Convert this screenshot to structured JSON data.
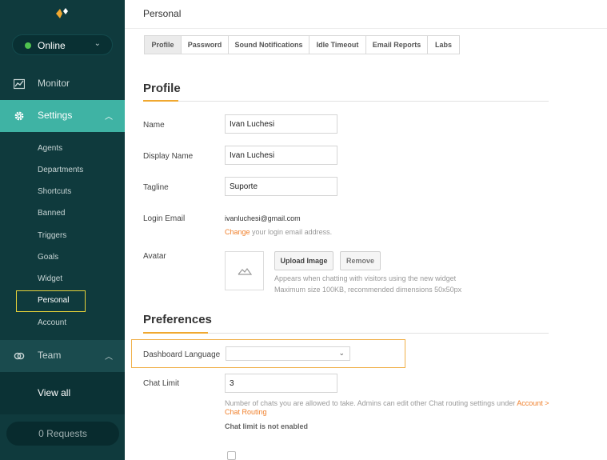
{
  "sidebar": {
    "status": {
      "label": "Online",
      "dot_color": "#4fc24f"
    },
    "nav": {
      "monitor": "Monitor",
      "settings": "Settings",
      "team": "Team"
    },
    "settings_items": [
      "Agents",
      "Departments",
      "Shortcuts",
      "Banned",
      "Triggers",
      "Goals",
      "Widget",
      "Personal",
      "Account"
    ],
    "active_item": "Personal",
    "view_all": "View all",
    "requests": "0 Requests",
    "colors": {
      "bg": "#0f3a3d",
      "active": "#3fb3a4",
      "highlight_box": "#e6d23a"
    }
  },
  "main": {
    "title": "Personal",
    "tabs": [
      "Profile",
      "Password",
      "Sound Notifications",
      "Idle Timeout",
      "Email Reports",
      "Labs"
    ],
    "active_tab": "Profile",
    "profile": {
      "heading": "Profile",
      "name_label": "Name",
      "name_value": "Ivan Luchesi",
      "display_name_label": "Display Name",
      "display_name_value": "Ivan Luchesi",
      "tagline_label": "Tagline",
      "tagline_value": "Suporte",
      "login_email_label": "Login Email",
      "login_email_value": "ivanluchesi@gmail.com",
      "change_link": "Change",
      "change_suffix": " your login email address.",
      "avatar_label": "Avatar",
      "upload_button": "Upload Image",
      "remove_button": "Remove",
      "avatar_hint_1": "Appears when chatting with visitors using the new widget",
      "avatar_hint_2": "Maximum size 100KB, recommended dimensions 50x50px"
    },
    "preferences": {
      "heading": "Preferences",
      "dashboard_language_label": "Dashboard Language",
      "dashboard_language_value": "",
      "chat_limit_label": "Chat Limit",
      "chat_limit_value": "3",
      "chat_limit_hint": "Number of chats you are allowed to take. Admins can edit other Chat routing settings under ",
      "chat_limit_link": "Account > Chat Routing",
      "chat_limit_status": "Chat limit is not enabled"
    },
    "colors": {
      "accent": "#f0a830",
      "link": "#f07f2a"
    }
  }
}
